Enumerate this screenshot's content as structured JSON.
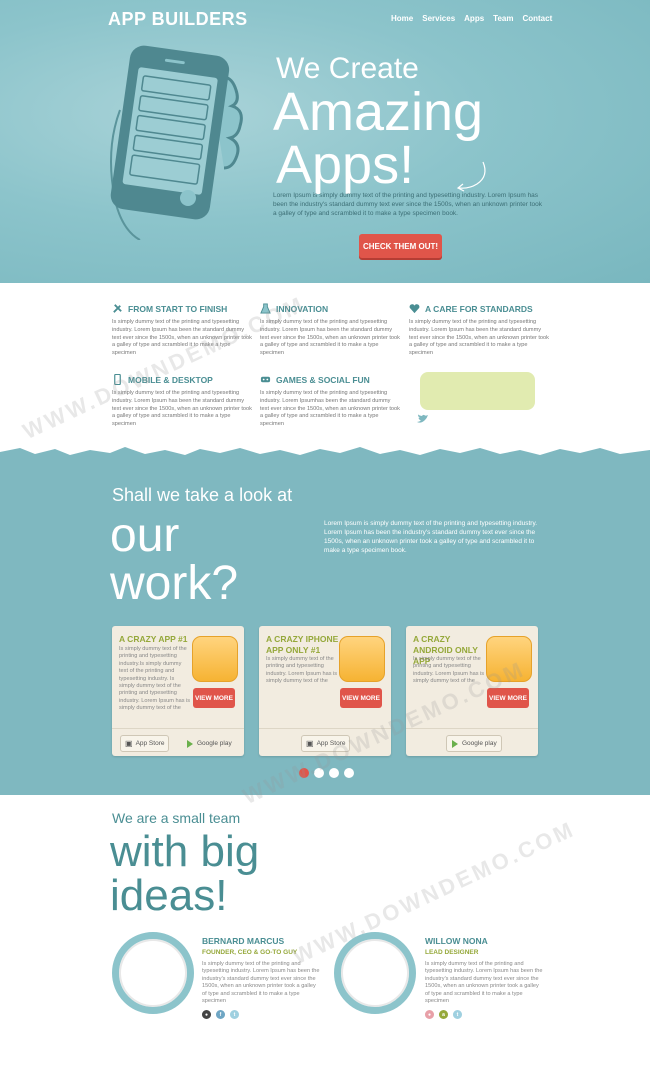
{
  "brand": {
    "logo": "APP BUILDERS"
  },
  "nav": [
    "Home",
    "Services",
    "Apps",
    "Team",
    "Contact"
  ],
  "hero": {
    "subtitle": "We Create",
    "line1": "Amazing",
    "line2": "Apps!",
    "description": "Lorem Ipsum is simply dummy text of the printing and typesetting industry. Lorem Ipsum has been the industry's standard dummy text ever since the 1500s, when an unknown printer took a galley of type and scrambled it to make a type specimen book.",
    "cta": "CHECK THEM OUT!"
  },
  "features": [
    {
      "title": "FROM START TO FINISH",
      "icon": "tools-icon",
      "text": "Is simply dummy text of the printing and typesetting industry. Lorem Ipsum has been the standard dummy text ever since the 1500s, when an unknown printer took a galley of type and scrambled it to make a type specimen"
    },
    {
      "title": "INNOVATION",
      "icon": "flask-icon",
      "text": "Is simply dummy text of the printing and typesetting industry. Lorem Ipsum has been the standard dummy text ever since the 1500s, when an unknown printer took a galley of type and scrambled it to make a type specimen"
    },
    {
      "title": "A CARE FOR STANDARDS",
      "icon": "heart-icon",
      "text": "Is simply dummy text of the printing and typesetting industry. Lorem Ipsum has been the standard dummy text ever since the 1500s, when an unknown printer took a galley of type and scrambled it to make a type specimen"
    },
    {
      "title": "MOBILE & DESKTOP",
      "icon": "mobile-icon",
      "text": "Is simply dummy text of the printing and typesetting industry. Lorem Ipsum has been the standard dummy text ever since the 1500s, when an unknown printer took a galley of type and scrambled it to make a type specimen"
    },
    {
      "title": "GAMES & SOCIAL FUN",
      "icon": "gamepad-icon",
      "text": "Is simply dummy text of the printing and typesetting industry. Lorem Ipsumhas been the standard dummy text ever since the 1500s, when an unknown printer took a galley of type and scrambled it to make a type specimen"
    }
  ],
  "work": {
    "subtitle": "Shall we take a look at",
    "line1": "our",
    "line2": "work?",
    "description": "Lorem Ipsum is simply dummy text of the printing and typesetting industry. Lorem Ipsum has been the industry's standard dummy text ever since the 1500s, when an unknown printer took a galley of type and scrambled it to make a type specimen book.",
    "cards": [
      {
        "title": "A CRAZY APP #1",
        "text": "Is simply dummy text of the printing and typesetting industry.Is simply dummy text of the printing and typesetting industry. Is simply dummy text of the printing and typesetting industry. Lorem Ipsum has is simply dummy text of the",
        "button": "VIEW MORE",
        "stores": [
          "App Store",
          "Google play"
        ]
      },
      {
        "title": "A CRAZY IPHONE APP ONLY #1",
        "text": "Is simply dummy text of the printing and typesetting industry. Lorem Ipsum has is simply dummy text of the",
        "button": "VIEW MORE",
        "stores": [
          "App Store"
        ]
      },
      {
        "title": "A CRAZY ANDROID ONLY APP",
        "text": "Is simply dummy text of the printing and typesetting industry. Lorem Ipsum has is simply dummy text of the",
        "button": "VIEW MORE",
        "stores": [
          "Google play"
        ]
      }
    ],
    "store_caption": "Available on the"
  },
  "team": {
    "subtitle": "We are a small team",
    "line1": "with big",
    "line2": "ideas!",
    "members": [
      {
        "name": "BERNARD MARCUS",
        "role": "FOUNDER, CEO & GO-TO GUY",
        "bio": "Is simply dummy text of the printing and typesetting industry. Lorem Ipsum has been the industry's standard dummy text ever since the 1500s, when an unknown printer took a galley of type and scrambled it to make a type specimen"
      },
      {
        "name": "WILLOW NONA",
        "role": "LEAD DESIGNER",
        "bio": "Is simply dummy text of the printing and typesetting industry. Lorem Ipsum has been the industry's standard dummy text ever since the 1500s, when an unknown printer took a galley of type and scrambled it to make a type specimen"
      }
    ]
  },
  "watermark": "WWW.DOWNDEMO.COM",
  "colors": {
    "teal": "#7fb8c0",
    "accent_red": "#e0554a",
    "olive": "#95a83a",
    "dark_teal": "#4a8e93"
  }
}
